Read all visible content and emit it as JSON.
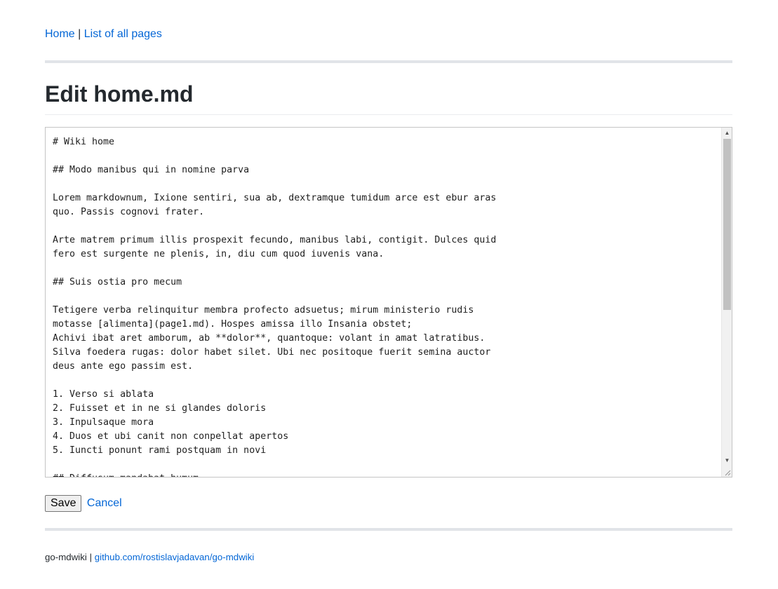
{
  "nav": {
    "home_label": "Home",
    "separator": "|",
    "all_pages_label": "List of all pages"
  },
  "page_title": "Edit home.md",
  "editor": {
    "content": "# Wiki home\n\n## Modo manibus qui in nomine parva\n\nLorem markdownum, Ixione sentiri, sua ab, dextramque tumidum arce est ebur aras\nquo. Passis cognovi frater.\n\nArte matrem primum illis prospexit fecundo, manibus labi, contigit. Dulces quid\nfero est surgente ne plenis, in, diu cum quod iuvenis vana.\n\n## Suis ostia pro mecum\n\nTetigere verba relinquitur membra profecto adsuetus; mirum ministerio rudis\nmotasse [alimenta](page1.md). Hospes amissa illo Insania obstet;\nAchivi ibat aret amborum, ab **dolor**, quantoque: volant in amat latratibus.\nSilva foedera rugas: dolor habet silet. Ubi nec positoque fuerit semina auctor\ndeus ante ego passim est.\n\n1. Verso si ablata\n2. Fuisset et in ne si glandes doloris\n3. Inpulsaque mora\n4. Duos et ubi canit non conpellat apertos\n5. Iuncti ponunt rami postquam in novi\n\n## Diffusum mandabat humum",
    "scroll_up_glyph": "▲",
    "scroll_down_glyph": "▼"
  },
  "actions": {
    "save_label": "Save",
    "cancel_label": "Cancel"
  },
  "footer": {
    "app_name": "go-mdwiki",
    "separator": "|",
    "repo_link": "github.com/rostislavjadavan/go-mdwiki"
  },
  "colors": {
    "link": "#0366d6",
    "rule": "#e1e4e8",
    "text": "#24292e"
  },
  "icons": {
    "scroll_up": "triangle-up-icon",
    "scroll_down": "triangle-down-icon",
    "resize": "resize-grip-icon"
  }
}
